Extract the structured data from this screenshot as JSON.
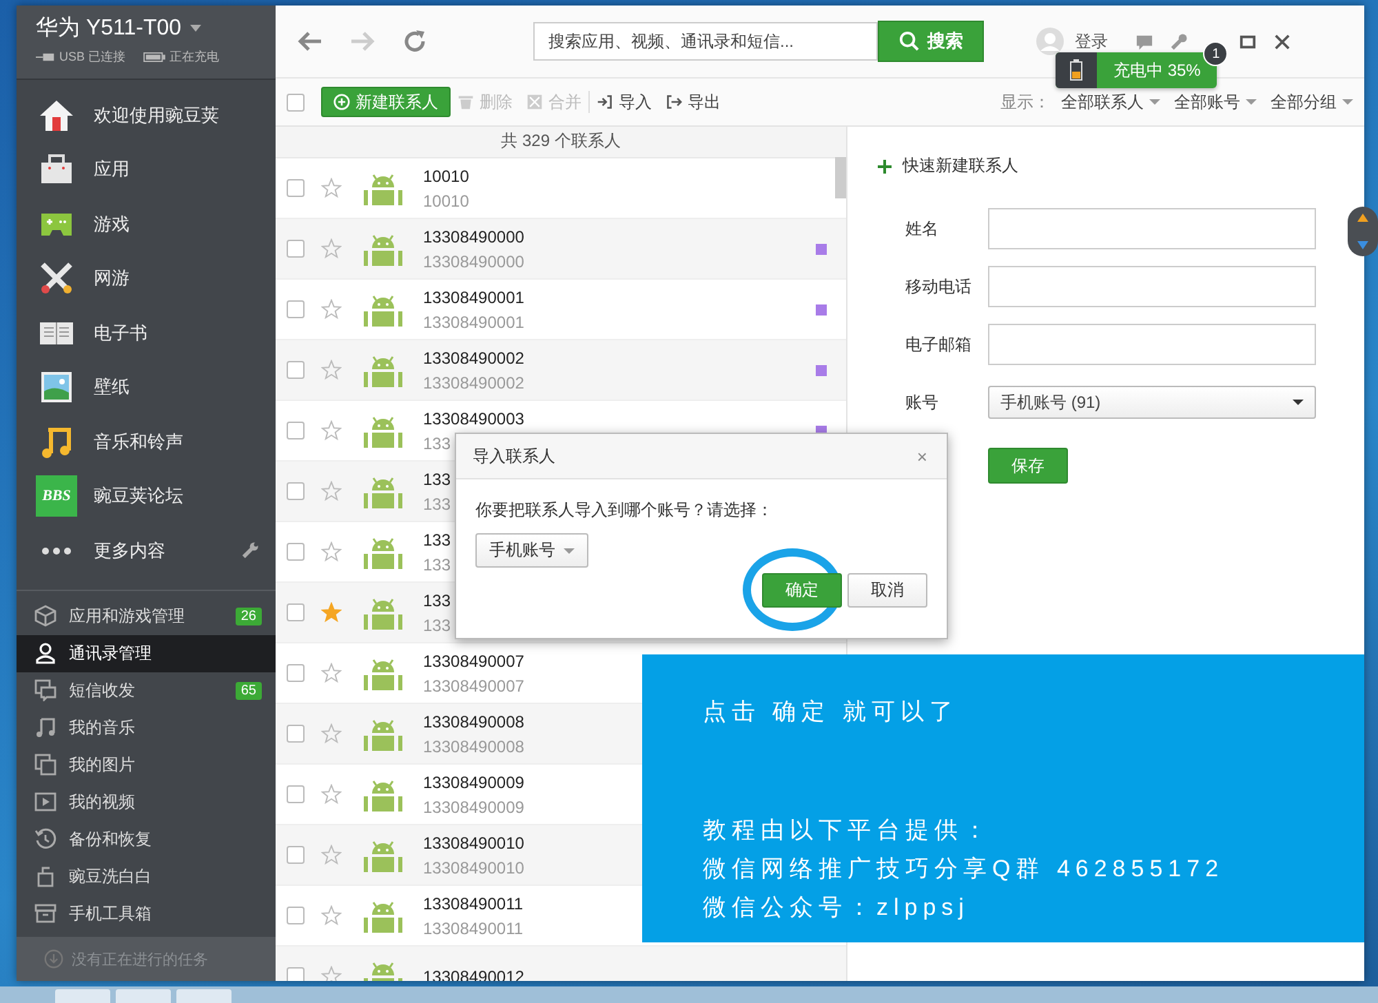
{
  "device": {
    "name": "华为 Y511-T00",
    "usb": "USB 已连接",
    "charging": "正在充电"
  },
  "nav": [
    {
      "label": "欢迎使用豌豆荚"
    },
    {
      "label": "应用"
    },
    {
      "label": "游戏"
    },
    {
      "label": "网游"
    },
    {
      "label": "电子书"
    },
    {
      "label": "壁纸"
    },
    {
      "label": "音乐和铃声"
    },
    {
      "label": "豌豆荚论坛",
      "logo_text": "BBS"
    },
    {
      "label": "更多内容",
      "tool": true
    }
  ],
  "manage": [
    {
      "label": "应用和游戏管理",
      "badge": "26",
      "selected": false
    },
    {
      "label": "通讯录管理",
      "selected": true
    },
    {
      "label": "短信收发",
      "badge": "65",
      "selected": false
    },
    {
      "label": "我的音乐",
      "selected": false
    },
    {
      "label": "我的图片",
      "selected": false
    },
    {
      "label": "我的视频",
      "selected": false
    },
    {
      "label": "备份和恢复",
      "selected": false
    },
    {
      "label": "豌豆洗白白",
      "selected": false
    },
    {
      "label": "手机工具箱",
      "selected": false
    }
  ],
  "tasks": "没有正在进行的任务",
  "toolbar": {
    "search_placeholder": "搜索应用、视频、通讯录和短信...",
    "search_button": "搜索",
    "login": "登录",
    "forward_disabled": true
  },
  "charge_popup": {
    "text": "充电中 35%",
    "badge": "1"
  },
  "actions": {
    "select_all_checked": false,
    "new_contact": "新建联系人",
    "buttons": [
      {
        "kind": "delete",
        "label": "删除",
        "disabled": true
      },
      {
        "kind": "merge",
        "label": "合并",
        "disabled": true
      },
      {
        "kind": "import",
        "label": "导入",
        "disabled": false
      },
      {
        "kind": "export",
        "label": "导出",
        "disabled": false
      }
    ],
    "show_label": "显示：",
    "filters": [
      "全部联系人",
      "全部账号",
      "全部分组"
    ]
  },
  "count": "共 329 个联系人",
  "contacts": [
    {
      "name": "10010",
      "number": "10010",
      "checked": false,
      "starred": false
    },
    {
      "name": "13308490000",
      "number": "13308490000",
      "checked": false,
      "starred": false,
      "color": "#a87ce8"
    },
    {
      "name": "13308490001",
      "number": "13308490001",
      "checked": false,
      "starred": false,
      "color": "#a87ce8"
    },
    {
      "name": "13308490002",
      "number": "13308490002",
      "checked": false,
      "starred": false,
      "color": "#a87ce8"
    },
    {
      "name": "13308490003",
      "number": "133",
      "checked": false,
      "starred": false,
      "color": "#a87ce8"
    },
    {
      "name": "133",
      "number": "133",
      "checked": false,
      "starred": false
    },
    {
      "name": "133",
      "number": "133",
      "checked": false,
      "starred": false
    },
    {
      "name": "133",
      "number": "133",
      "checked": false,
      "starred": true
    },
    {
      "name": "13308490007",
      "number": "13308490007",
      "checked": false,
      "starred": false
    },
    {
      "name": "13308490008",
      "number": "13308490008",
      "checked": false,
      "starred": false
    },
    {
      "name": "13308490009",
      "number": "13308490009",
      "checked": false,
      "starred": false
    },
    {
      "name": "13308490010",
      "number": "13308490010",
      "checked": false,
      "starred": false
    },
    {
      "name": "13308490011",
      "number": "13308490011",
      "checked": false,
      "starred": false
    },
    {
      "name": "13308490012",
      "checked": false,
      "starred": false
    }
  ],
  "quick_new": {
    "title": "快速新建联系人",
    "fields": [
      {
        "kind": "input",
        "label": "姓名"
      },
      {
        "kind": "input",
        "label": "移动电话"
      },
      {
        "kind": "input",
        "label": "电子邮箱"
      },
      {
        "kind": "select",
        "label": "账号",
        "value": "手机账号 (91)"
      }
    ],
    "save": "保存"
  },
  "dialog": {
    "title": "导入联系人",
    "close": "×",
    "question": "你要把联系人导入到哪个账号？请选择：",
    "account": "手机账号",
    "ok": "确定",
    "cancel": "取消",
    "ok_circled": true
  },
  "note_panel": {
    "instruction": "点击 确定 就可以了",
    "credits": [
      "教程由以下平台提供：",
      "微信网络推广技巧分享Q群 462855172",
      "微信公众号：zlppsj"
    ]
  }
}
